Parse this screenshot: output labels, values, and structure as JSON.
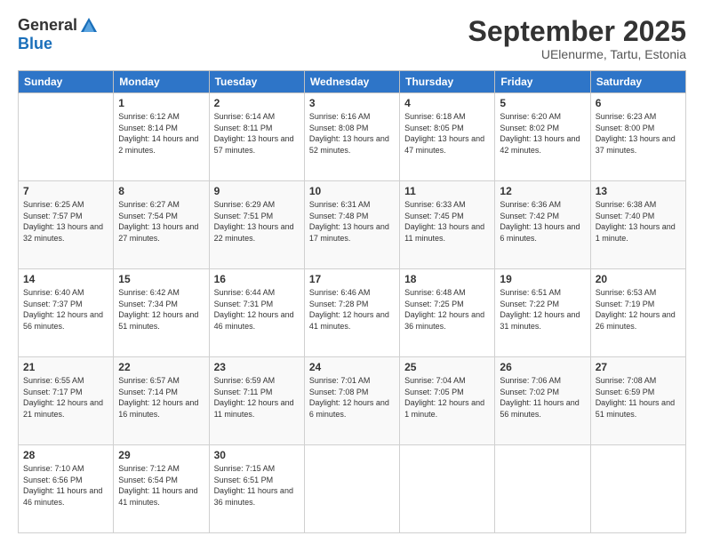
{
  "header": {
    "logo_general": "General",
    "logo_blue": "Blue",
    "month": "September 2025",
    "location": "UElenurme, Tartu, Estonia"
  },
  "weekdays": [
    "Sunday",
    "Monday",
    "Tuesday",
    "Wednesday",
    "Thursday",
    "Friday",
    "Saturday"
  ],
  "weeks": [
    [
      {
        "day": "",
        "sunrise": "",
        "sunset": "",
        "daylight": ""
      },
      {
        "day": "1",
        "sunrise": "Sunrise: 6:12 AM",
        "sunset": "Sunset: 8:14 PM",
        "daylight": "Daylight: 14 hours and 2 minutes."
      },
      {
        "day": "2",
        "sunrise": "Sunrise: 6:14 AM",
        "sunset": "Sunset: 8:11 PM",
        "daylight": "Daylight: 13 hours and 57 minutes."
      },
      {
        "day": "3",
        "sunrise": "Sunrise: 6:16 AM",
        "sunset": "Sunset: 8:08 PM",
        "daylight": "Daylight: 13 hours and 52 minutes."
      },
      {
        "day": "4",
        "sunrise": "Sunrise: 6:18 AM",
        "sunset": "Sunset: 8:05 PM",
        "daylight": "Daylight: 13 hours and 47 minutes."
      },
      {
        "day": "5",
        "sunrise": "Sunrise: 6:20 AM",
        "sunset": "Sunset: 8:02 PM",
        "daylight": "Daylight: 13 hours and 42 minutes."
      },
      {
        "day": "6",
        "sunrise": "Sunrise: 6:23 AM",
        "sunset": "Sunset: 8:00 PM",
        "daylight": "Daylight: 13 hours and 37 minutes."
      }
    ],
    [
      {
        "day": "7",
        "sunrise": "Sunrise: 6:25 AM",
        "sunset": "Sunset: 7:57 PM",
        "daylight": "Daylight: 13 hours and 32 minutes."
      },
      {
        "day": "8",
        "sunrise": "Sunrise: 6:27 AM",
        "sunset": "Sunset: 7:54 PM",
        "daylight": "Daylight: 13 hours and 27 minutes."
      },
      {
        "day": "9",
        "sunrise": "Sunrise: 6:29 AM",
        "sunset": "Sunset: 7:51 PM",
        "daylight": "Daylight: 13 hours and 22 minutes."
      },
      {
        "day": "10",
        "sunrise": "Sunrise: 6:31 AM",
        "sunset": "Sunset: 7:48 PM",
        "daylight": "Daylight: 13 hours and 17 minutes."
      },
      {
        "day": "11",
        "sunrise": "Sunrise: 6:33 AM",
        "sunset": "Sunset: 7:45 PM",
        "daylight": "Daylight: 13 hours and 11 minutes."
      },
      {
        "day": "12",
        "sunrise": "Sunrise: 6:36 AM",
        "sunset": "Sunset: 7:42 PM",
        "daylight": "Daylight: 13 hours and 6 minutes."
      },
      {
        "day": "13",
        "sunrise": "Sunrise: 6:38 AM",
        "sunset": "Sunset: 7:40 PM",
        "daylight": "Daylight: 13 hours and 1 minute."
      }
    ],
    [
      {
        "day": "14",
        "sunrise": "Sunrise: 6:40 AM",
        "sunset": "Sunset: 7:37 PM",
        "daylight": "Daylight: 12 hours and 56 minutes."
      },
      {
        "day": "15",
        "sunrise": "Sunrise: 6:42 AM",
        "sunset": "Sunset: 7:34 PM",
        "daylight": "Daylight: 12 hours and 51 minutes."
      },
      {
        "day": "16",
        "sunrise": "Sunrise: 6:44 AM",
        "sunset": "Sunset: 7:31 PM",
        "daylight": "Daylight: 12 hours and 46 minutes."
      },
      {
        "day": "17",
        "sunrise": "Sunrise: 6:46 AM",
        "sunset": "Sunset: 7:28 PM",
        "daylight": "Daylight: 12 hours and 41 minutes."
      },
      {
        "day": "18",
        "sunrise": "Sunrise: 6:48 AM",
        "sunset": "Sunset: 7:25 PM",
        "daylight": "Daylight: 12 hours and 36 minutes."
      },
      {
        "day": "19",
        "sunrise": "Sunrise: 6:51 AM",
        "sunset": "Sunset: 7:22 PM",
        "daylight": "Daylight: 12 hours and 31 minutes."
      },
      {
        "day": "20",
        "sunrise": "Sunrise: 6:53 AM",
        "sunset": "Sunset: 7:19 PM",
        "daylight": "Daylight: 12 hours and 26 minutes."
      }
    ],
    [
      {
        "day": "21",
        "sunrise": "Sunrise: 6:55 AM",
        "sunset": "Sunset: 7:17 PM",
        "daylight": "Daylight: 12 hours and 21 minutes."
      },
      {
        "day": "22",
        "sunrise": "Sunrise: 6:57 AM",
        "sunset": "Sunset: 7:14 PM",
        "daylight": "Daylight: 12 hours and 16 minutes."
      },
      {
        "day": "23",
        "sunrise": "Sunrise: 6:59 AM",
        "sunset": "Sunset: 7:11 PM",
        "daylight": "Daylight: 12 hours and 11 minutes."
      },
      {
        "day": "24",
        "sunrise": "Sunrise: 7:01 AM",
        "sunset": "Sunset: 7:08 PM",
        "daylight": "Daylight: 12 hours and 6 minutes."
      },
      {
        "day": "25",
        "sunrise": "Sunrise: 7:04 AM",
        "sunset": "Sunset: 7:05 PM",
        "daylight": "Daylight: 12 hours and 1 minute."
      },
      {
        "day": "26",
        "sunrise": "Sunrise: 7:06 AM",
        "sunset": "Sunset: 7:02 PM",
        "daylight": "Daylight: 11 hours and 56 minutes."
      },
      {
        "day": "27",
        "sunrise": "Sunrise: 7:08 AM",
        "sunset": "Sunset: 6:59 PM",
        "daylight": "Daylight: 11 hours and 51 minutes."
      }
    ],
    [
      {
        "day": "28",
        "sunrise": "Sunrise: 7:10 AM",
        "sunset": "Sunset: 6:56 PM",
        "daylight": "Daylight: 11 hours and 46 minutes."
      },
      {
        "day": "29",
        "sunrise": "Sunrise: 7:12 AM",
        "sunset": "Sunset: 6:54 PM",
        "daylight": "Daylight: 11 hours and 41 minutes."
      },
      {
        "day": "30",
        "sunrise": "Sunrise: 7:15 AM",
        "sunset": "Sunset: 6:51 PM",
        "daylight": "Daylight: 11 hours and 36 minutes."
      },
      {
        "day": "",
        "sunrise": "",
        "sunset": "",
        "daylight": ""
      },
      {
        "day": "",
        "sunrise": "",
        "sunset": "",
        "daylight": ""
      },
      {
        "day": "",
        "sunrise": "",
        "sunset": "",
        "daylight": ""
      },
      {
        "day": "",
        "sunrise": "",
        "sunset": "",
        "daylight": ""
      }
    ]
  ]
}
